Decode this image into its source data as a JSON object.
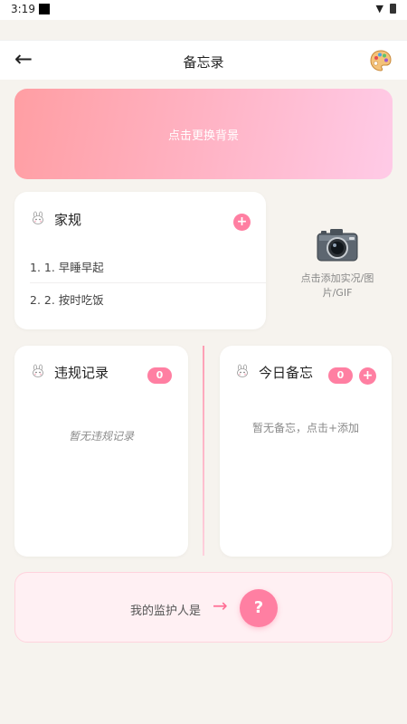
{
  "status_bar": {
    "time": "3:19"
  },
  "app_bar": {
    "back_icon": "arrow-left-icon",
    "title": "备忘录",
    "palette_icon": "palette-icon"
  },
  "banner": {
    "text": "点击更换背景"
  },
  "rules": {
    "title": "家规",
    "add_label": "+",
    "items": [
      "1. 1. 早睡早起",
      "2. 2. 按时吃饭"
    ]
  },
  "photo": {
    "icon": "camera-icon",
    "hint": "点击添加实况/图片/GIF"
  },
  "violations": {
    "title": "违规记录",
    "count": "0",
    "empty": "暂无违规记录"
  },
  "memo": {
    "title": "今日备忘",
    "count": "0",
    "add_label": "+",
    "empty": "暂无备忘，点击+添加"
  },
  "guardian": {
    "label": "我的监护人是",
    "arrow": "→",
    "help": "?"
  },
  "colors": {
    "accent": "#ff7fa2",
    "background": "#f6f3ee",
    "banner_start": "#ff9ea3",
    "banner_end": "#ffcbe7"
  }
}
